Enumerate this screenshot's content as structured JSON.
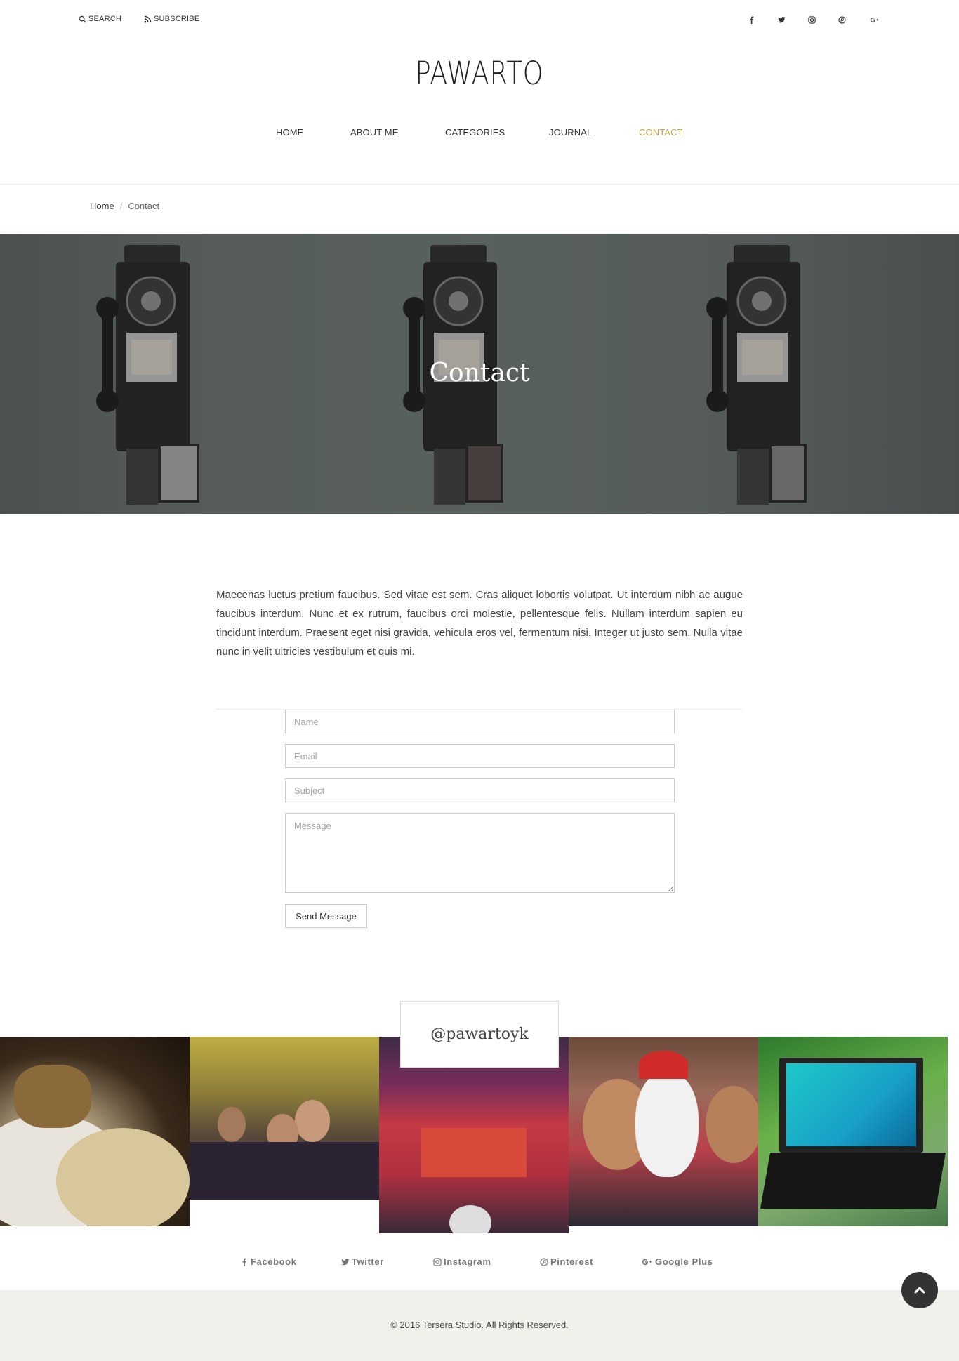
{
  "topbar": {
    "search_label": "SEARCH",
    "subscribe_label": "SUBSCRIBE",
    "social_icons": [
      "facebook-icon",
      "twitter-icon",
      "instagram-icon",
      "pinterest-icon",
      "google-plus-icon"
    ]
  },
  "site": {
    "logo": "PAWARTO"
  },
  "nav": {
    "items": [
      {
        "label": "HOME",
        "active": false
      },
      {
        "label": "ABOUT ME",
        "active": false
      },
      {
        "label": "CATEGORIES",
        "active": false
      },
      {
        "label": "JOURNAL",
        "active": false
      },
      {
        "label": "CONTACT",
        "active": true
      }
    ]
  },
  "breadcrumb": {
    "home": "Home",
    "separator": "/",
    "current": "Contact"
  },
  "hero": {
    "title": "Contact"
  },
  "intro": {
    "text": "Maecenas luctus pretium faucibus. Sed vitae est sem. Cras aliquet lobortis volutpat. Ut interdum nibh ac augue faucibus interdum. Nunc et ex rutrum, faucibus orci molestie, pellentesque felis. Nullam interdum sapien eu tincidunt interdum. Praesent eget nisi gravida, vehicula eros vel, fermentum nisi. Integer ut justo sem. Nulla vitae nunc in velit ultricies vestibulum et quis mi."
  },
  "form": {
    "name_placeholder": "Name",
    "email_placeholder": "Email",
    "subject_placeholder": "Subject",
    "message_placeholder": "Message",
    "send_label": "Send Message"
  },
  "instagram": {
    "handle": "@pawartoyk"
  },
  "footer_social": {
    "facebook": "Facebook",
    "twitter": "Twitter",
    "instagram": "Instagram",
    "pinterest": "Pinterest",
    "google_plus": "Google Plus"
  },
  "footer": {
    "copyright": "© 2016 Tersera Studio. All Rights Reserved."
  },
  "colors": {
    "accent": "#c8a24b",
    "footer_bg": "#f1f1ec",
    "scroll_button": "#333333"
  }
}
